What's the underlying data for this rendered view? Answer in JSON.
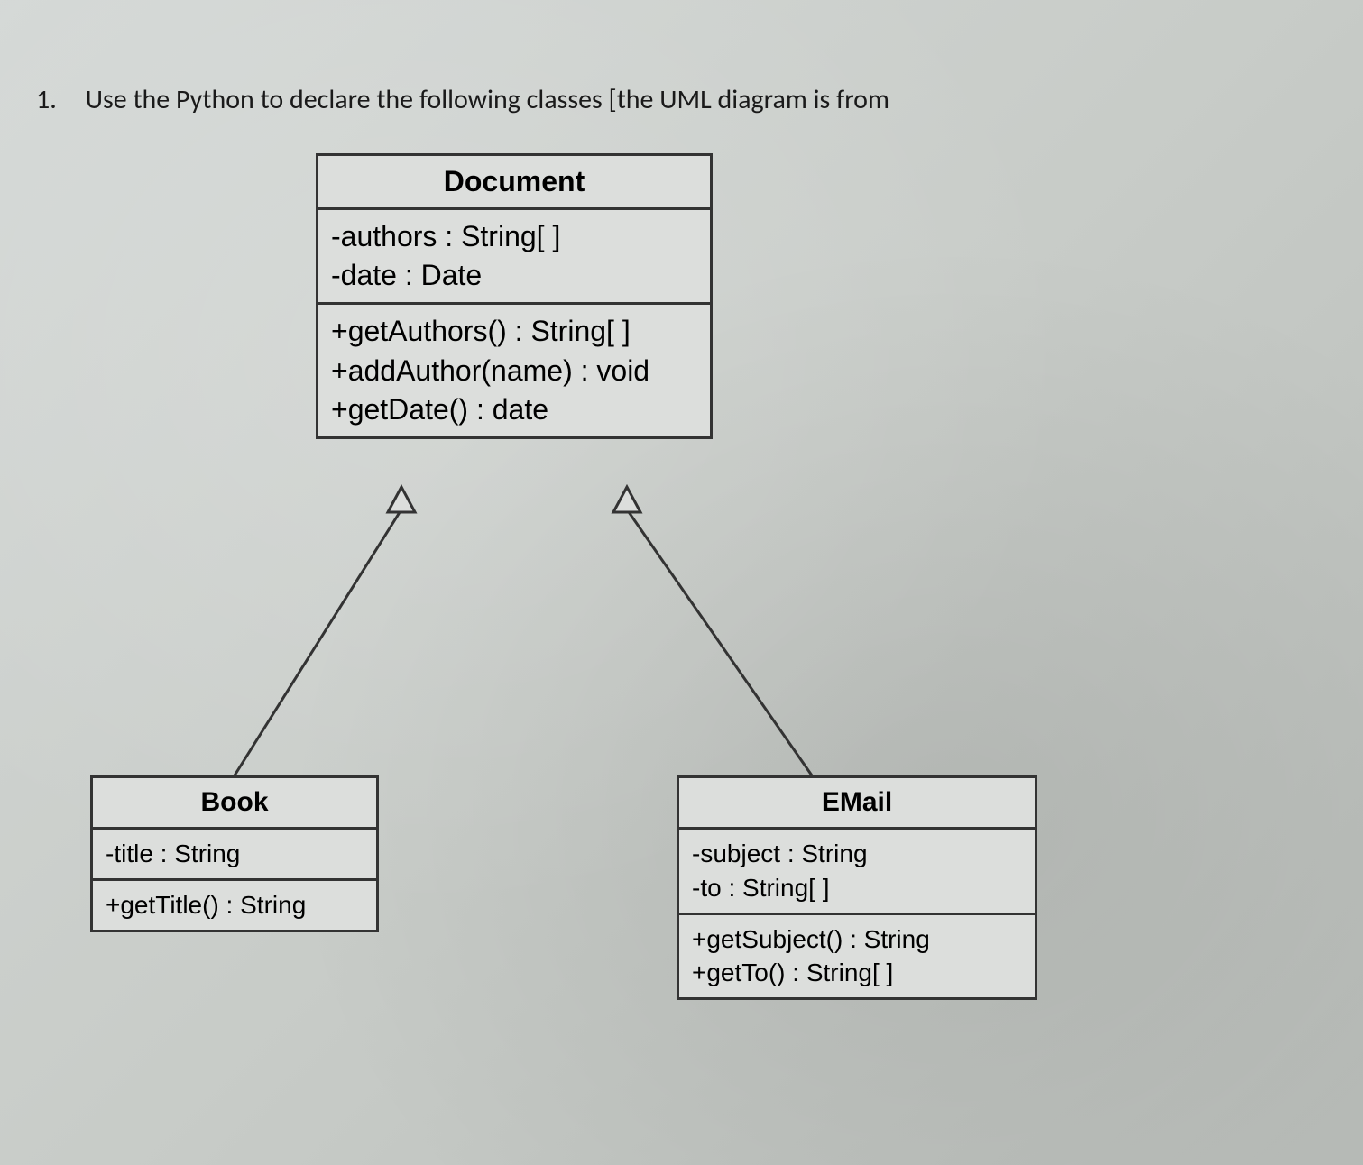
{
  "question": {
    "number": "1.",
    "text": "Use the Python to declare the following classes [the UML diagram is from"
  },
  "classes": {
    "document": {
      "name": "Document",
      "attributes": [
        "-authors : String[ ]",
        "-date : Date"
      ],
      "methods": [
        "+getAuthors() : String[ ]",
        "+addAuthor(name) : void",
        "+getDate() : date"
      ]
    },
    "book": {
      "name": "Book",
      "attributes": [
        "-title : String"
      ],
      "methods": [
        "+getTitle() : String"
      ]
    },
    "email": {
      "name": "EMail",
      "attributes": [
        "-subject : String",
        "-to : String[ ]"
      ],
      "methods": [
        "+getSubject() : String",
        "+getTo() : String[ ]"
      ]
    }
  },
  "relationships": [
    {
      "from": "book",
      "to": "document",
      "type": "inheritance"
    },
    {
      "from": "email",
      "to": "document",
      "type": "inheritance"
    }
  ]
}
